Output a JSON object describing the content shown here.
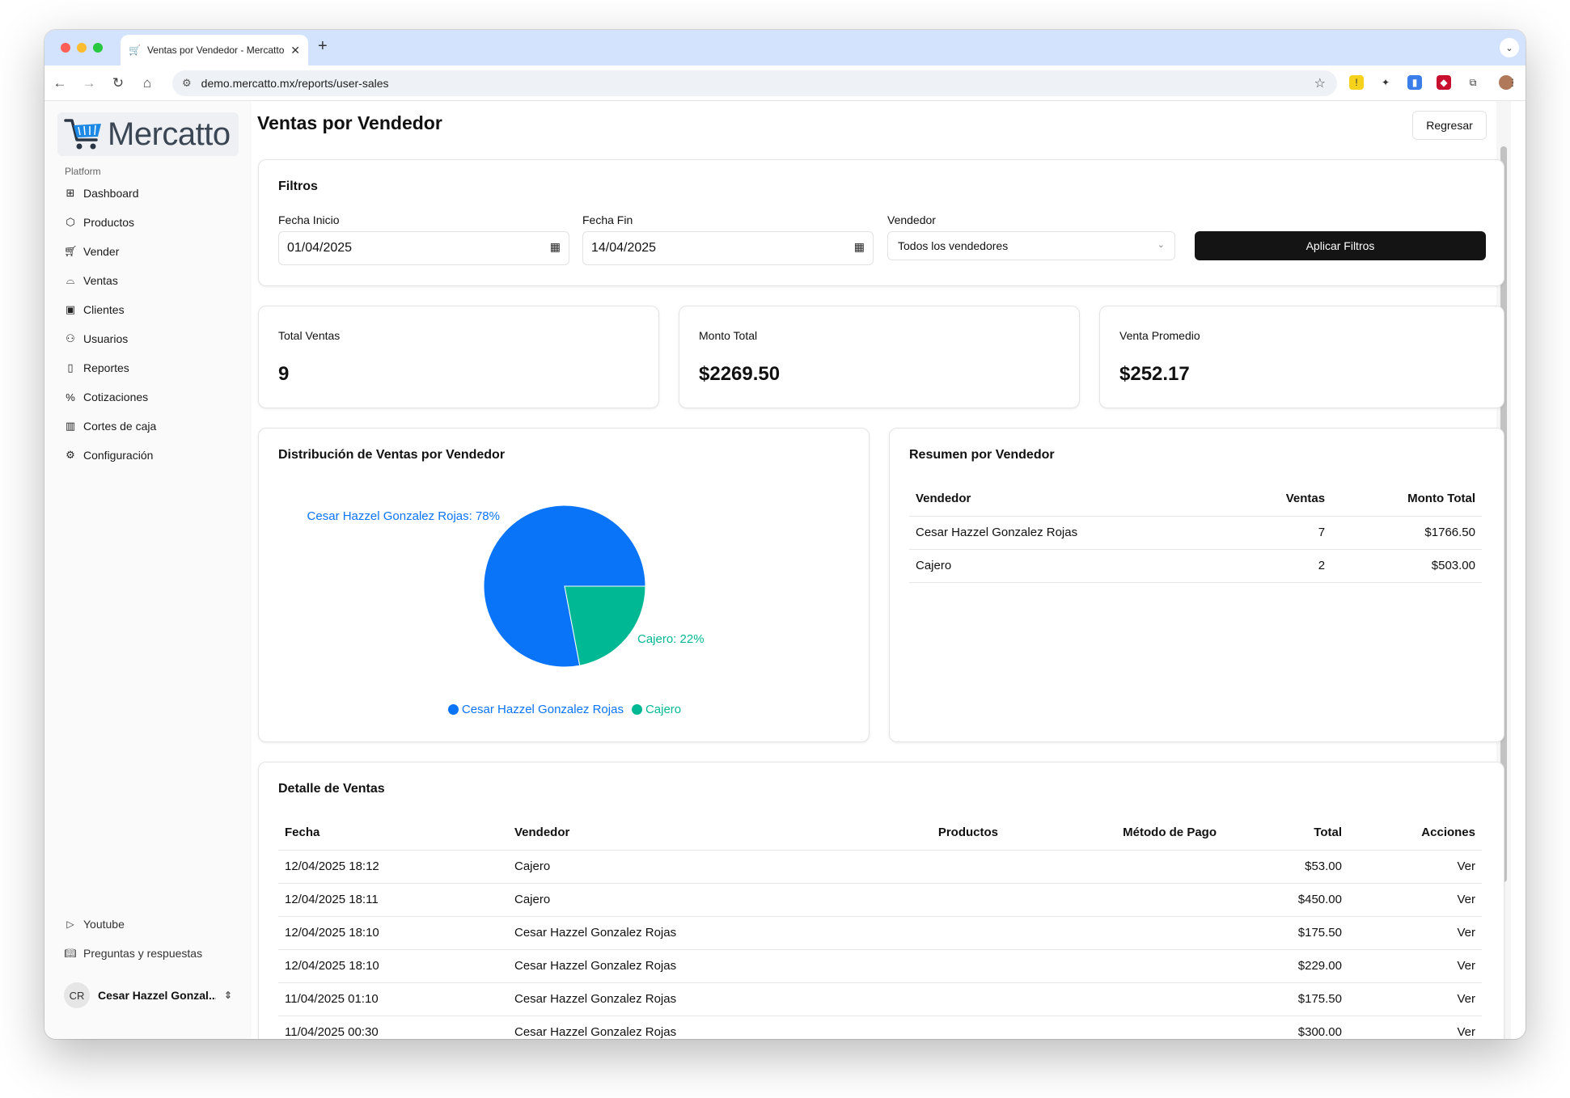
{
  "browser": {
    "tab_title": "Ventas por Vendedor - Mercatto",
    "url": "demo.mercatto.mx/reports/user-sales"
  },
  "sidebar": {
    "brand": "Mercatto",
    "section_label": "Platform",
    "items": [
      {
        "label": "Dashboard",
        "icon": "grid-icon"
      },
      {
        "label": "Productos",
        "icon": "package-icon"
      },
      {
        "label": "Vender",
        "icon": "cart-icon"
      },
      {
        "label": "Ventas",
        "icon": "basket-icon"
      },
      {
        "label": "Clientes",
        "icon": "contact-icon"
      },
      {
        "label": "Usuarios",
        "icon": "users-icon"
      },
      {
        "label": "Reportes",
        "icon": "clipboard-icon"
      },
      {
        "label": "Cotizaciones",
        "icon": "percent-icon"
      },
      {
        "label": "Cortes de caja",
        "icon": "chart-icon"
      },
      {
        "label": "Configuración",
        "icon": "gear-icon"
      }
    ],
    "secondary": [
      {
        "label": "Youtube",
        "icon": "youtube-icon"
      },
      {
        "label": "Preguntas y respuestas",
        "icon": "book-icon"
      }
    ],
    "user": {
      "initials": "CR",
      "name": "Cesar Hazzel Gonzal..."
    }
  },
  "header": {
    "title": "Ventas por Vendedor",
    "back_label": "Regresar"
  },
  "filters": {
    "title": "Filtros",
    "start_label": "Fecha Inicio",
    "start_value": "01/04/2025",
    "end_label": "Fecha Fin",
    "end_value": "14/04/2025",
    "seller_label": "Vendedor",
    "seller_value": "Todos los vendedores",
    "apply_label": "Aplicar Filtros"
  },
  "stats": [
    {
      "label": "Total Ventas",
      "value": "9"
    },
    {
      "label": "Monto Total",
      "value": "$2269.50"
    },
    {
      "label": "Venta Promedio",
      "value": "$252.17"
    }
  ],
  "distribution": {
    "title": "Distribución de Ventas por Vendedor"
  },
  "chart_data": {
    "type": "pie",
    "categories": [
      "Cesar Hazzel Gonzalez Rojas",
      "Cajero"
    ],
    "values": [
      78,
      22
    ],
    "slice_labels": [
      "Cesar Hazzel Gonzalez Rojas: 78%",
      "Cajero: 22%"
    ],
    "colors": [
      "#0a74f8",
      "#00b894"
    ],
    "legend": "bottom"
  },
  "summary": {
    "title": "Resumen por Vendedor",
    "columns": [
      "Vendedor",
      "Ventas",
      "Monto Total"
    ],
    "rows": [
      [
        "Cesar Hazzel Gonzalez Rojas",
        "7",
        "$1766.50"
      ],
      [
        "Cajero",
        "2",
        "$503.00"
      ]
    ]
  },
  "detail": {
    "title": "Detalle de Ventas",
    "columns": [
      "Fecha",
      "Vendedor",
      "Productos",
      "Método de Pago",
      "Total",
      "Acciones"
    ],
    "rows": [
      [
        "12/04/2025 18:12",
        "Cajero",
        "",
        "",
        "$53.00",
        "Ver"
      ],
      [
        "12/04/2025 18:11",
        "Cajero",
        "",
        "",
        "$450.00",
        "Ver"
      ],
      [
        "12/04/2025 18:10",
        "Cesar Hazzel Gonzalez Rojas",
        "",
        "",
        "$175.50",
        "Ver"
      ],
      [
        "12/04/2025 18:10",
        "Cesar Hazzel Gonzalez Rojas",
        "",
        "",
        "$229.00",
        "Ver"
      ],
      [
        "11/04/2025 01:10",
        "Cesar Hazzel Gonzalez Rojas",
        "",
        "",
        "$175.50",
        "Ver"
      ],
      [
        "11/04/2025 00:30",
        "Cesar Hazzel Gonzalez Rojas",
        "",
        "",
        "$300.00",
        "Ver"
      ]
    ]
  }
}
